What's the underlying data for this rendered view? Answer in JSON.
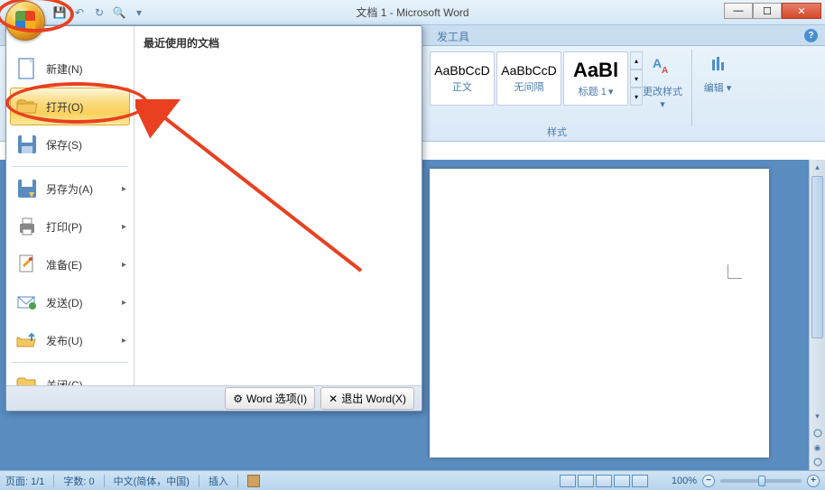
{
  "window": {
    "title": "文档 1 - Microsoft Word"
  },
  "ribbon": {
    "partial_tab": "发工具",
    "styles": {
      "item1_preview": "AaBbCcD",
      "item1_label": "正文",
      "item2_preview": "AaBbCcD",
      "item2_label": "无间隔",
      "item3_preview": "AaBl",
      "item3_label": "标题 1",
      "change_label": "更改样式",
      "group_label": "样式"
    },
    "edit_label": "编辑"
  },
  "office_menu": {
    "recent_title": "最近使用的文档",
    "items": {
      "new": "新建(N)",
      "open": "打开(O)",
      "save": "保存(S)",
      "save_as": "另存为(A)",
      "print": "打印(P)",
      "prepare": "准备(E)",
      "send": "发送(D)",
      "publish": "发布(U)",
      "close": "关闭(C)"
    },
    "bottom": {
      "options": "Word 选项(I)",
      "exit": "退出 Word(X)"
    }
  },
  "statusbar": {
    "page": "页面: 1/1",
    "words": "字数: 0",
    "lang": "中文(简体，中国)",
    "mode": "插入",
    "zoom": "100%"
  }
}
